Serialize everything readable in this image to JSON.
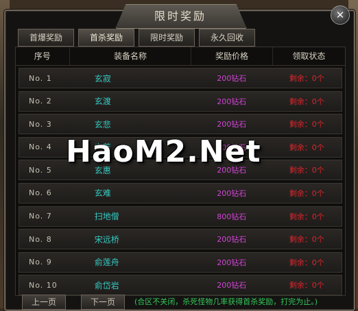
{
  "window": {
    "title": "限时奖励",
    "close_glyph": "✕"
  },
  "tabs": [
    {
      "label": "首爆奖励",
      "active": false
    },
    {
      "label": "首杀奖励",
      "active": true
    },
    {
      "label": "限时奖励",
      "active": false
    },
    {
      "label": "永久回收",
      "active": false
    }
  ],
  "table": {
    "headers": [
      "序号",
      "装备名称",
      "奖励价格",
      "领取状态"
    ],
    "rows": [
      {
        "no": "No.  1",
        "name": "玄寂",
        "price": "200钻石",
        "status": "剩余：0个"
      },
      {
        "no": "No.  2",
        "name": "玄渡",
        "price": "200钻石",
        "status": "剩余：0个"
      },
      {
        "no": "No.  3",
        "name": "玄悲",
        "price": "200钻石",
        "status": "剩余：0个"
      },
      {
        "no": "No.  4",
        "name": "玄苦",
        "price": "200钻石",
        "status": "剩余：0个"
      },
      {
        "no": "No.  5",
        "name": "玄惠",
        "price": "200钻石",
        "status": "剩余：0个"
      },
      {
        "no": "No.  6",
        "name": "玄难",
        "price": "200钻石",
        "status": "剩余：0个"
      },
      {
        "no": "No.  7",
        "name": "扫地僧",
        "price": "800钻石",
        "status": "剩余：0个"
      },
      {
        "no": "No.  8",
        "name": "宋远桥",
        "price": "200钻石",
        "status": "剩余：0个"
      },
      {
        "no": "No.  9",
        "name": "俞莲舟",
        "price": "200钻石",
        "status": "剩余：0个"
      },
      {
        "no": "No.  10",
        "name": "俞岱岩",
        "price": "200钻石",
        "status": "剩余：0个"
      }
    ]
  },
  "footer": {
    "prev_label": "上一页",
    "next_label": "下一页",
    "notice": "(合区不关闭，杀死怪物几率获得首杀奖励，打完为止。)"
  },
  "watermark": "HaoM2.Net",
  "colors": {
    "item_name": "#35c9c0",
    "price": "#d244d6",
    "status": "#e0242c",
    "notice": "#35c95a"
  }
}
